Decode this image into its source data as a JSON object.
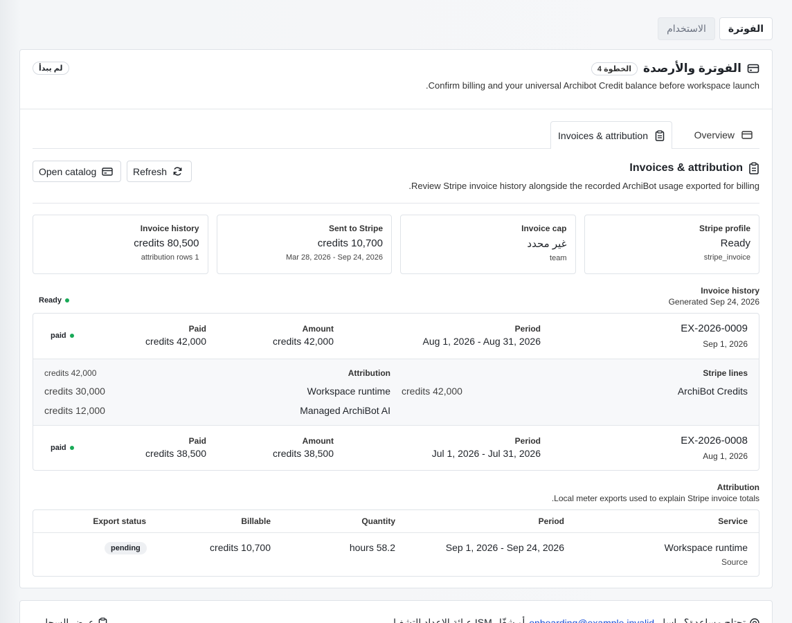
{
  "top_tabs": {
    "billing": "الفوترة",
    "usage": "الاستخدام"
  },
  "header": {
    "title": "الفوترة والأرصدة",
    "step": "الخطوة 4",
    "subtitle": "Confirm billing and your universal Archibot Credit balance before workspace launch.",
    "status": "لم يبدأ"
  },
  "inner_tabs": {
    "invoices": "Invoices & attribution",
    "overview": "Overview"
  },
  "section": {
    "title": "Invoices & attribution",
    "subtitle": "Review Stripe invoice history alongside the recorded ArchiBot usage exported for billing.",
    "refresh": "Refresh",
    "open_catalog": "Open catalog"
  },
  "stats": [
    {
      "label": "Stripe profile",
      "value": "Ready",
      "sub": "stripe_invoice"
    },
    {
      "label": "Invoice cap",
      "value": "غير محدد",
      "sub": "team"
    },
    {
      "label": "Sent to Stripe",
      "value": "credits 10,700",
      "sub": "Mar 28, 2026 - Sep 24, 2026"
    },
    {
      "label": "Invoice history",
      "value": "credits 80,500",
      "sub": "1 attribution rows"
    }
  ],
  "invoice_history": {
    "title": "Invoice history",
    "generated": "Generated Sep 24, 2026",
    "status": "Ready",
    "labels": {
      "period": "Period",
      "amount": "Amount",
      "paid": "Paid"
    },
    "invoices": [
      {
        "id": "EX-2026-0009",
        "date": "Sep 1, 2026",
        "period": "Aug 1, 2026 - Aug 31, 2026",
        "amount": "credits 42,000",
        "paid": "credits 42,000",
        "status": "paid"
      },
      {
        "id": "EX-2026-0008",
        "date": "Aug 1, 2026",
        "period": "Jul 1, 2026 - Jul 31, 2026",
        "amount": "credits 38,500",
        "paid": "credits 38,500",
        "status": "paid"
      }
    ],
    "lines": {
      "stripe_title": "Stripe lines",
      "stripe_name": "ArchiBot Credits",
      "stripe_amount": "credits 42,000",
      "attr_title": "Attribution",
      "attr_total": "credits 42,000",
      "attr_rows": [
        {
          "name": "Workspace runtime",
          "amount": "credits 30,000"
        },
        {
          "name": "Managed ArchiBot AI",
          "amount": "credits 12,000"
        }
      ]
    }
  },
  "attribution": {
    "title": "Attribution",
    "subtitle": "Local meter exports used to explain Stripe invoice totals.",
    "headers": {
      "service": "Service",
      "period": "Period",
      "quantity": "Quantity",
      "billable": "Billable",
      "export": "Export status"
    },
    "row": {
      "service": "Workspace runtime",
      "source": "Source",
      "period": "Sep 1, 2026 - Sep 24, 2026",
      "quantity": "hours 58.2",
      "billable": "credits 10,700",
      "export": "pending"
    }
  },
  "footer": {
    "help_prefix": "تحتاج مساعدة؟ راسل",
    "email": "onboarding@example.invalid",
    "help_suffix": "أو شغّل ISM عبائة الإعداد التشغيلي",
    "toggle_log": "عرض السجل"
  },
  "colors": {
    "accent": "#18a957",
    "link": "#1a4fd6"
  }
}
